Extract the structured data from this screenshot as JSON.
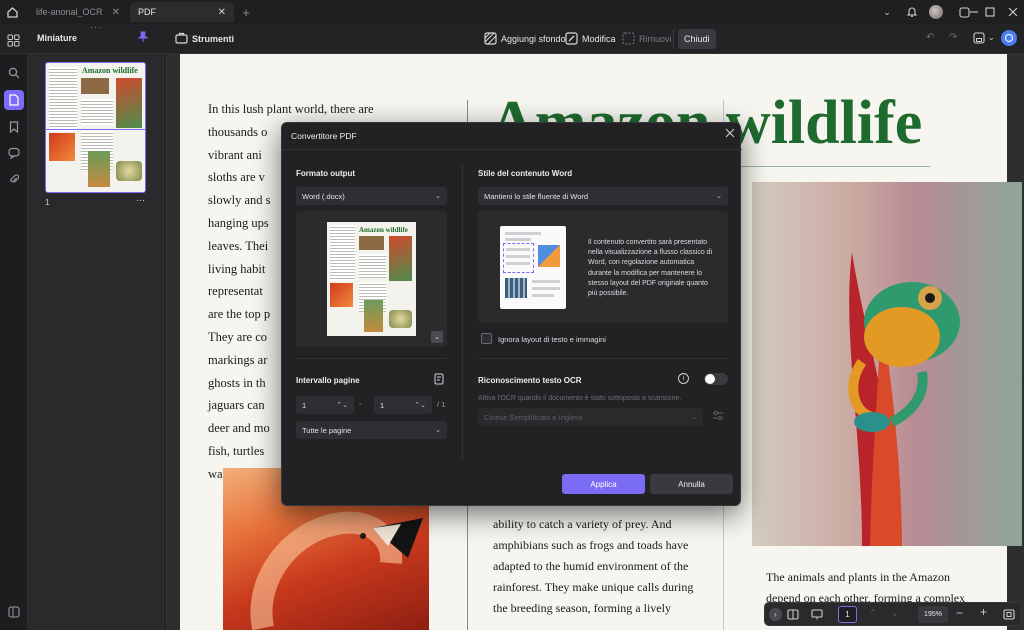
{
  "tabs": [
    {
      "label": "life-anonal_OCR",
      "active": false
    },
    {
      "label": "PDF",
      "active": true
    }
  ],
  "toolbar": {
    "tools_label": "Strumenti",
    "add_bg": "Aggiungi sfondo",
    "edit": "Modifica",
    "remove": "Rimuovi",
    "close": "Chiudi"
  },
  "thumbnail_panel": {
    "title": "Miniature",
    "page_number": "1",
    "more": "···"
  },
  "document": {
    "title": "Amazon wildlife",
    "col1_lines": [
      "In this lush plant world, there are",
      "thousands o",
      "vibrant ani",
      "sloths are v",
      "slowly and s",
      "hanging ups",
      "leaves. Thei",
      "living habit",
      "representat",
      "are the top p",
      "They are co",
      "markings ar",
      "ghosts in th",
      "jaguars can",
      "deer and mo",
      "fish, turtles",
      "water."
    ],
    "col2_lines": [
      "ability to catch a variety of prey. And",
      "amphibians such as frogs and toads have",
      "adapted to the humid environment of the",
      "rainforest. They make unique calls during",
      "the breeding season, forming a lively"
    ],
    "col3_lines": [
      "The animals and plants in the Amazon",
      "depend on each other, forming a complex"
    ]
  },
  "dialog": {
    "title": "Convertitore PDF",
    "output_format_label": "Formato output",
    "output_format_value": "Word (.docx)",
    "preview_title": "Amazon wildlife",
    "word_style_label": "Stile del contenuto Word",
    "word_style_value": "Mantieni lo stile fluente di Word",
    "style_description": "Il contenuto convertito sarà presentato nella visualizzazione a flusso classico di Word, con regolazione automatica durante la modifica per mantenere lo stesso layout del PDF originale quanto più possibile.",
    "ignore_layout_label": "Ignora layout di testo e immagini",
    "page_range_label": "Intervallo pagine",
    "page_from": "1",
    "page_to": "1",
    "page_total": "/ 1",
    "range_separator": "-",
    "page_range_value": "Tutte le pagine",
    "ocr_label": "Riconoscimento testo OCR",
    "ocr_hint": "Attiva l'OCR quando il documento è stato sottoposto a scansione.",
    "ocr_language": "Cinese Semplificato e Inglese",
    "apply": "Applica",
    "cancel": "Annulla"
  },
  "bottom_bar": {
    "page": "1",
    "zoom": "195%",
    "minus": "−",
    "plus": "+"
  },
  "colors": {
    "accent": "#7b6cf6",
    "title_green": "#1f6b2f",
    "dialog_bg": "#222225"
  }
}
